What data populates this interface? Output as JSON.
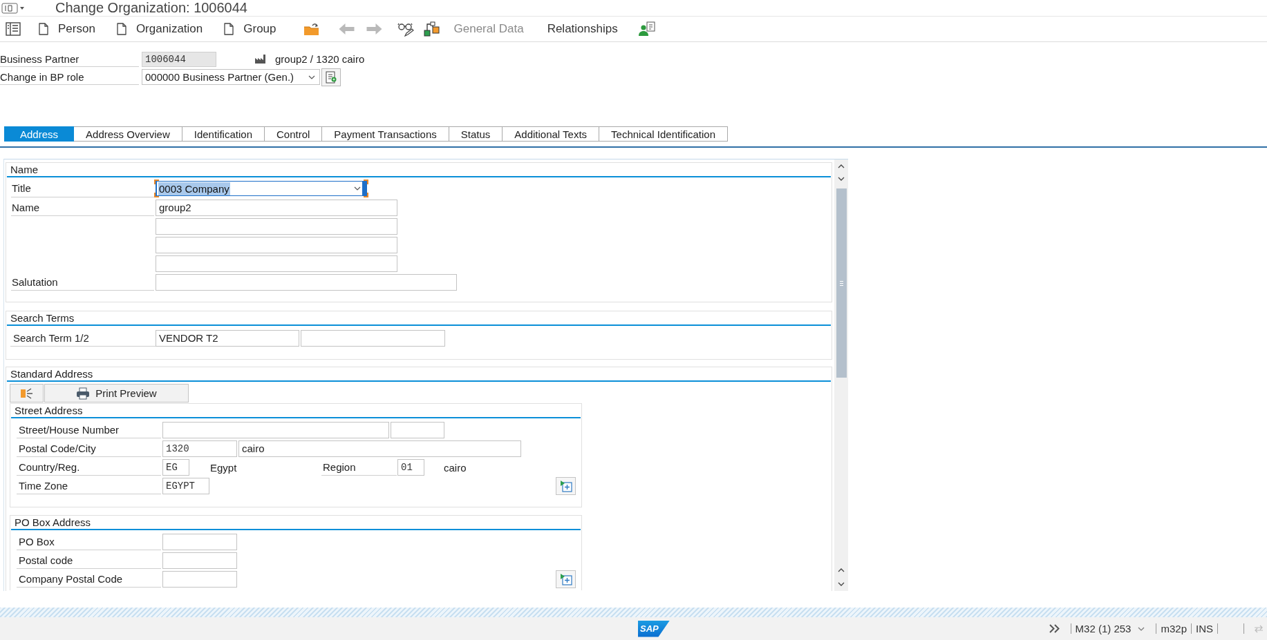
{
  "window": {
    "title": "Change Organization: 1006044"
  },
  "toolbar": {
    "object_buttons": [
      {
        "label": "Person"
      },
      {
        "label": "Organization"
      },
      {
        "label": "Group"
      }
    ],
    "nav_buttons": [
      {
        "disabled": true
      },
      {
        "disabled": true
      }
    ],
    "view_buttons": [
      {
        "label": "General Data",
        "disabled": true
      },
      {
        "label": "Relationships",
        "disabled": false
      }
    ]
  },
  "header": {
    "partner": {
      "label": "Business Partner",
      "value": "1006044",
      "description": "group2 / 1320 cairo"
    },
    "role": {
      "label": "Change in BP role",
      "value": "000000 Business Partner (Gen.)"
    }
  },
  "tabs": [
    {
      "label": "Address",
      "selected": true
    },
    {
      "label": "Address Overview",
      "selected": false
    },
    {
      "label": "Identification",
      "selected": false
    },
    {
      "label": "Control",
      "selected": false
    },
    {
      "label": "Payment Transactions",
      "selected": false
    },
    {
      "label": "Status",
      "selected": false
    },
    {
      "label": "Additional Texts",
      "selected": false
    },
    {
      "label": "Technical Identification",
      "selected": false
    }
  ],
  "name_section": {
    "title": "Name",
    "title_row": {
      "label": "Title",
      "value": "0003 Company",
      "focused": true
    },
    "name_row": {
      "label": "Name",
      "value": "group2"
    },
    "salutation_row": {
      "label": "Salutation"
    }
  },
  "search_section": {
    "title": "Search Terms",
    "row": {
      "label": "Search Term 1/2",
      "term_1": "VENDOR T2"
    }
  },
  "address_section": {
    "title": "Standard Address",
    "print_button": {
      "label": "Print Preview"
    },
    "street_address": {
      "title": "Street Address",
      "street_row": {
        "label": "Street/House Number"
      },
      "postal_row": {
        "label": "Postal Code/City",
        "postal_code": "1320",
        "city": "cairo"
      },
      "country_row": {
        "label": "Country/Reg.",
        "country": "EG",
        "country_name": "Egypt",
        "region_label": "Region",
        "region": "01",
        "region_name": "cairo"
      },
      "time_zone_row": {
        "label": "Time Zone",
        "value": "EGYPT"
      }
    },
    "po_box_address": {
      "title": "PO Box Address",
      "rows": [
        {
          "label": "PO Box"
        },
        {
          "label": "Postal code"
        },
        {
          "label": "Company Postal Code"
        }
      ]
    }
  },
  "status_bar": {
    "logo": "SAP",
    "system": "M32 (1) 253",
    "server": "m32p",
    "mode": "INS"
  }
}
